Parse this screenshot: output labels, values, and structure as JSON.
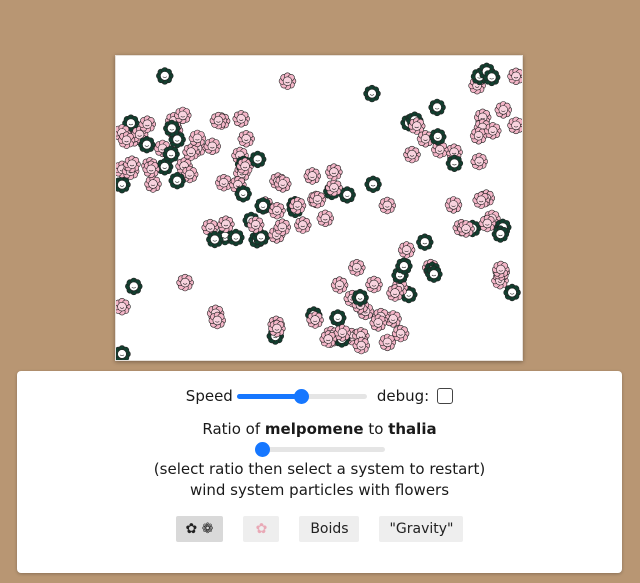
{
  "controls": {
    "speed_label": "Speed",
    "speed_value": 0.5,
    "debug_label": "debug:",
    "debug_checked": false,
    "ratio_prefix": "Ratio of",
    "ratio_first": "melpomene",
    "ratio_middle": "to",
    "ratio_second": "thalia",
    "ratio_value": 0.0,
    "hint": "(select ratio then select a system to restart)",
    "description": "wind system particles with flowers"
  },
  "buttons": [
    {
      "label": "✿ ❁",
      "name": "wind-system-button",
      "active": true
    },
    {
      "label": "✿",
      "name": "flower-system-button",
      "active": false
    },
    {
      "label": "Boids",
      "name": "boids-button",
      "active": false
    },
    {
      "label": "\"Gravity\"",
      "name": "gravity-button",
      "active": false
    }
  ],
  "colors": {
    "background": "#b89673",
    "accent": "#1677ff",
    "flower_pink": "#f4b6c8",
    "flower_dark": "#123f2f"
  }
}
